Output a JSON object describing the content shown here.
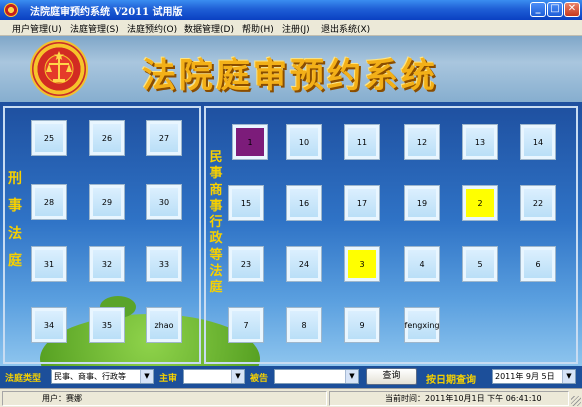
{
  "window": {
    "title": "法院庭审预约系统  V2011   试用版",
    "minimize": "_",
    "restore": "□",
    "close": "✕"
  },
  "menu": [
    "用户管理(U)",
    "法庭管理(S)",
    "法庭预约(O)",
    "数据管理(D)",
    "帮助(H)",
    "注册(J)",
    "退出系统(X)"
  ],
  "banner": {
    "title": "法院庭审预约系统",
    "emblem_icon": "court-emblem-icon"
  },
  "left_panel": {
    "label": "刑事法庭",
    "rooms": [
      "25",
      "26",
      "27",
      "28",
      "29",
      "30",
      "31",
      "32",
      "33",
      "34",
      "35",
      "zhao"
    ]
  },
  "right_panel": {
    "label": "民事商事行政等法庭",
    "rooms": [
      {
        "label": "1",
        "state": "purple"
      },
      {
        "label": "10",
        "state": "normal"
      },
      {
        "label": "11",
        "state": "normal"
      },
      {
        "label": "12",
        "state": "normal"
      },
      {
        "label": "13",
        "state": "normal"
      },
      {
        "label": "14",
        "state": "normal"
      },
      {
        "label": "15",
        "state": "normal"
      },
      {
        "label": "16",
        "state": "normal"
      },
      {
        "label": "17",
        "state": "normal"
      },
      {
        "label": "19",
        "state": "normal"
      },
      {
        "label": "2",
        "state": "yellow"
      },
      {
        "label": "22",
        "state": "normal"
      },
      {
        "label": "23",
        "state": "normal"
      },
      {
        "label": "24",
        "state": "normal"
      },
      {
        "label": "3",
        "state": "yellow"
      },
      {
        "label": "4",
        "state": "normal"
      },
      {
        "label": "5",
        "state": "normal"
      },
      {
        "label": "6",
        "state": "normal"
      },
      {
        "label": "7",
        "state": "normal"
      },
      {
        "label": "8",
        "state": "normal"
      },
      {
        "label": "9",
        "state": "normal"
      },
      {
        "label": "fengxing",
        "state": "normal"
      }
    ]
  },
  "colors": {
    "yellow": "#ffff00",
    "purple": "#7c1c7a",
    "accent": "#f5d000"
  },
  "toolbar": {
    "court_type_label": "法庭类型",
    "court_type_value": "民事、商事、行政等",
    "judge_label": "主审",
    "judge_value": "",
    "clerk_label": "被告",
    "clerk_value": "",
    "query_button": "查询",
    "date_query_label": "按日期查询",
    "date_value": "2011年 9月 5日"
  },
  "statusbar": {
    "user_label": "用户：",
    "user_value": "赛娜",
    "time_label": "当前时间：",
    "time_value": "2011年10月1日 下午 06:41:10"
  }
}
